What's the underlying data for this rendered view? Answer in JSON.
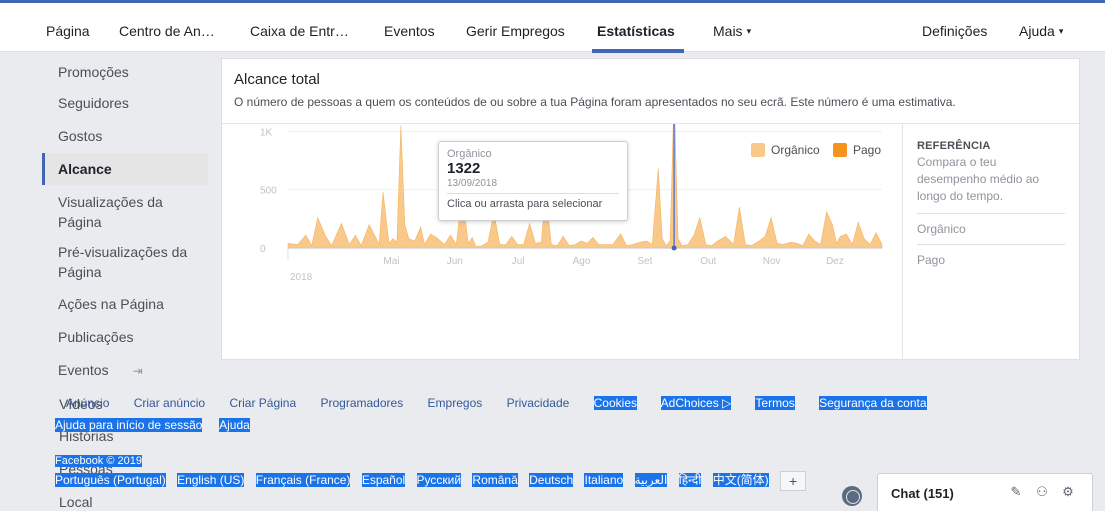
{
  "topnav": {
    "items": [
      "Página",
      "Centro de An…",
      "Caixa de Entr…",
      "Eventos",
      "Gerir Empregos",
      "Estatísticas",
      "Mais",
      "Definições",
      "Ajuda"
    ]
  },
  "sidebar": {
    "items": [
      "Promoções",
      "Seguidores",
      "Gostos",
      "Alcance",
      "Visualizações da Página",
      "Pré-visualizações da Página",
      "Ações na Página",
      "Publicações",
      "Eventos"
    ],
    "overlap_items": [
      "Vídeos",
      "Histórias",
      "Pessoas",
      "Local"
    ]
  },
  "card": {
    "title": "Alcance total",
    "description": "O número de pessoas a quem os conteúdos de ou sobre a tua Página foram apresentados no seu ecrã. Este número é uma estimativa."
  },
  "tooltip": {
    "series": "Orgânico",
    "value": "1322",
    "date": "13/09/2018",
    "hint": "Clica ou arrasta para selecionar"
  },
  "legend": {
    "organic": "Orgânico",
    "paid": "Pago",
    "organic_color": "#f9c98a",
    "paid_color": "#f7921e"
  },
  "reference": {
    "title": "REFERÊNCIA",
    "description": "Compara o teu desempenho médio ao longo do tempo.",
    "rows": [
      "Orgânico",
      "Pago"
    ]
  },
  "chart_data": {
    "type": "area",
    "y_ticks": [
      "0",
      "500",
      "1K"
    ],
    "ylim": [
      0,
      1500
    ],
    "x_ticks": [
      "Mai",
      "Jun",
      "Jul",
      "Ago",
      "Set",
      "Out",
      "Nov",
      "Dez"
    ],
    "year_label": "2018",
    "series": [
      {
        "name": "Orgânico",
        "points": [
          [
            0,
            40
          ],
          [
            5,
            30
          ],
          [
            9,
            110
          ],
          [
            12,
            20
          ],
          [
            15,
            260
          ],
          [
            19,
            100
          ],
          [
            22,
            20
          ],
          [
            27,
            210
          ],
          [
            31,
            30
          ],
          [
            34,
            110
          ],
          [
            37,
            20
          ],
          [
            41,
            200
          ],
          [
            44,
            100
          ],
          [
            46,
            30
          ],
          [
            48,
            480
          ],
          [
            51,
            40
          ],
          [
            53,
            80
          ],
          [
            55,
            50
          ],
          [
            57,
            1050
          ],
          [
            59,
            200
          ],
          [
            61,
            80
          ],
          [
            64,
            60
          ],
          [
            67,
            180
          ],
          [
            69,
            30
          ],
          [
            72,
            120
          ],
          [
            75,
            90
          ],
          [
            79,
            30
          ],
          [
            82,
            110
          ],
          [
            85,
            30
          ],
          [
            88,
            480
          ],
          [
            91,
            40
          ],
          [
            93,
            90
          ],
          [
            95,
            10
          ],
          [
            98,
            20
          ],
          [
            101,
            50
          ],
          [
            104,
            300
          ],
          [
            107,
            30
          ],
          [
            110,
            30
          ],
          [
            113,
            100
          ],
          [
            116,
            30
          ],
          [
            119,
            30
          ],
          [
            122,
            210
          ],
          [
            125,
            40
          ],
          [
            128,
            50
          ],
          [
            130,
            490
          ],
          [
            133,
            30
          ],
          [
            136,
            20
          ],
          [
            139,
            100
          ],
          [
            142,
            20
          ],
          [
            145,
            30
          ],
          [
            148,
            60
          ],
          [
            151,
            40
          ],
          [
            154,
            90
          ],
          [
            157,
            30
          ],
          [
            161,
            30
          ],
          [
            164,
            30
          ],
          [
            168,
            120
          ],
          [
            171,
            20
          ],
          [
            174,
            30
          ],
          [
            178,
            50
          ],
          [
            181,
            60
          ],
          [
            184,
            30
          ],
          [
            187,
            680
          ],
          [
            189,
            80
          ],
          [
            191,
            20
          ],
          [
            193,
            60
          ],
          [
            195,
            1322
          ],
          [
            197,
            80
          ],
          [
            199,
            20
          ],
          [
            202,
            30
          ],
          [
            205,
            110
          ],
          [
            208,
            260
          ],
          [
            211,
            30
          ],
          [
            214,
            20
          ],
          [
            217,
            60
          ],
          [
            221,
            100
          ],
          [
            225,
            30
          ],
          [
            228,
            350
          ],
          [
            231,
            30
          ],
          [
            234,
            20
          ],
          [
            238,
            60
          ],
          [
            241,
            100
          ],
          [
            244,
            260
          ],
          [
            247,
            40
          ],
          [
            250,
            30
          ],
          [
            254,
            50
          ],
          [
            257,
            40
          ],
          [
            260,
            20
          ],
          [
            263,
            120
          ],
          [
            266,
            60
          ],
          [
            269,
            30
          ],
          [
            272,
            310
          ],
          [
            275,
            200
          ],
          [
            277,
            40
          ],
          [
            279,
            100
          ],
          [
            282,
            120
          ],
          [
            285,
            30
          ],
          [
            288,
            220
          ],
          [
            291,
            80
          ],
          [
            294,
            30
          ],
          [
            297,
            130
          ],
          [
            300,
            30
          ]
        ]
      },
      {
        "name": "Pago",
        "points": []
      }
    ]
  },
  "footer": {
    "links": [
      "Anúncio",
      "Criar anúncio",
      "Criar Página",
      "Programadores",
      "Empregos",
      "Privacidade",
      "Cookies",
      "AdChoices",
      "Termos",
      "Segurança da conta"
    ],
    "line2": [
      "Ajuda para início de sessão",
      "Ajuda"
    ],
    "copyright": "Facebook © 2019",
    "languages": [
      "Português (Portugal)",
      "English (US)",
      "Français (France)",
      "Español",
      "Русский",
      "Română",
      "Deutsch",
      "Italiano",
      "العربية",
      "हिन्दी",
      "中文(简体)"
    ],
    "more": "+"
  },
  "chat": {
    "label": "Chat (151)"
  }
}
